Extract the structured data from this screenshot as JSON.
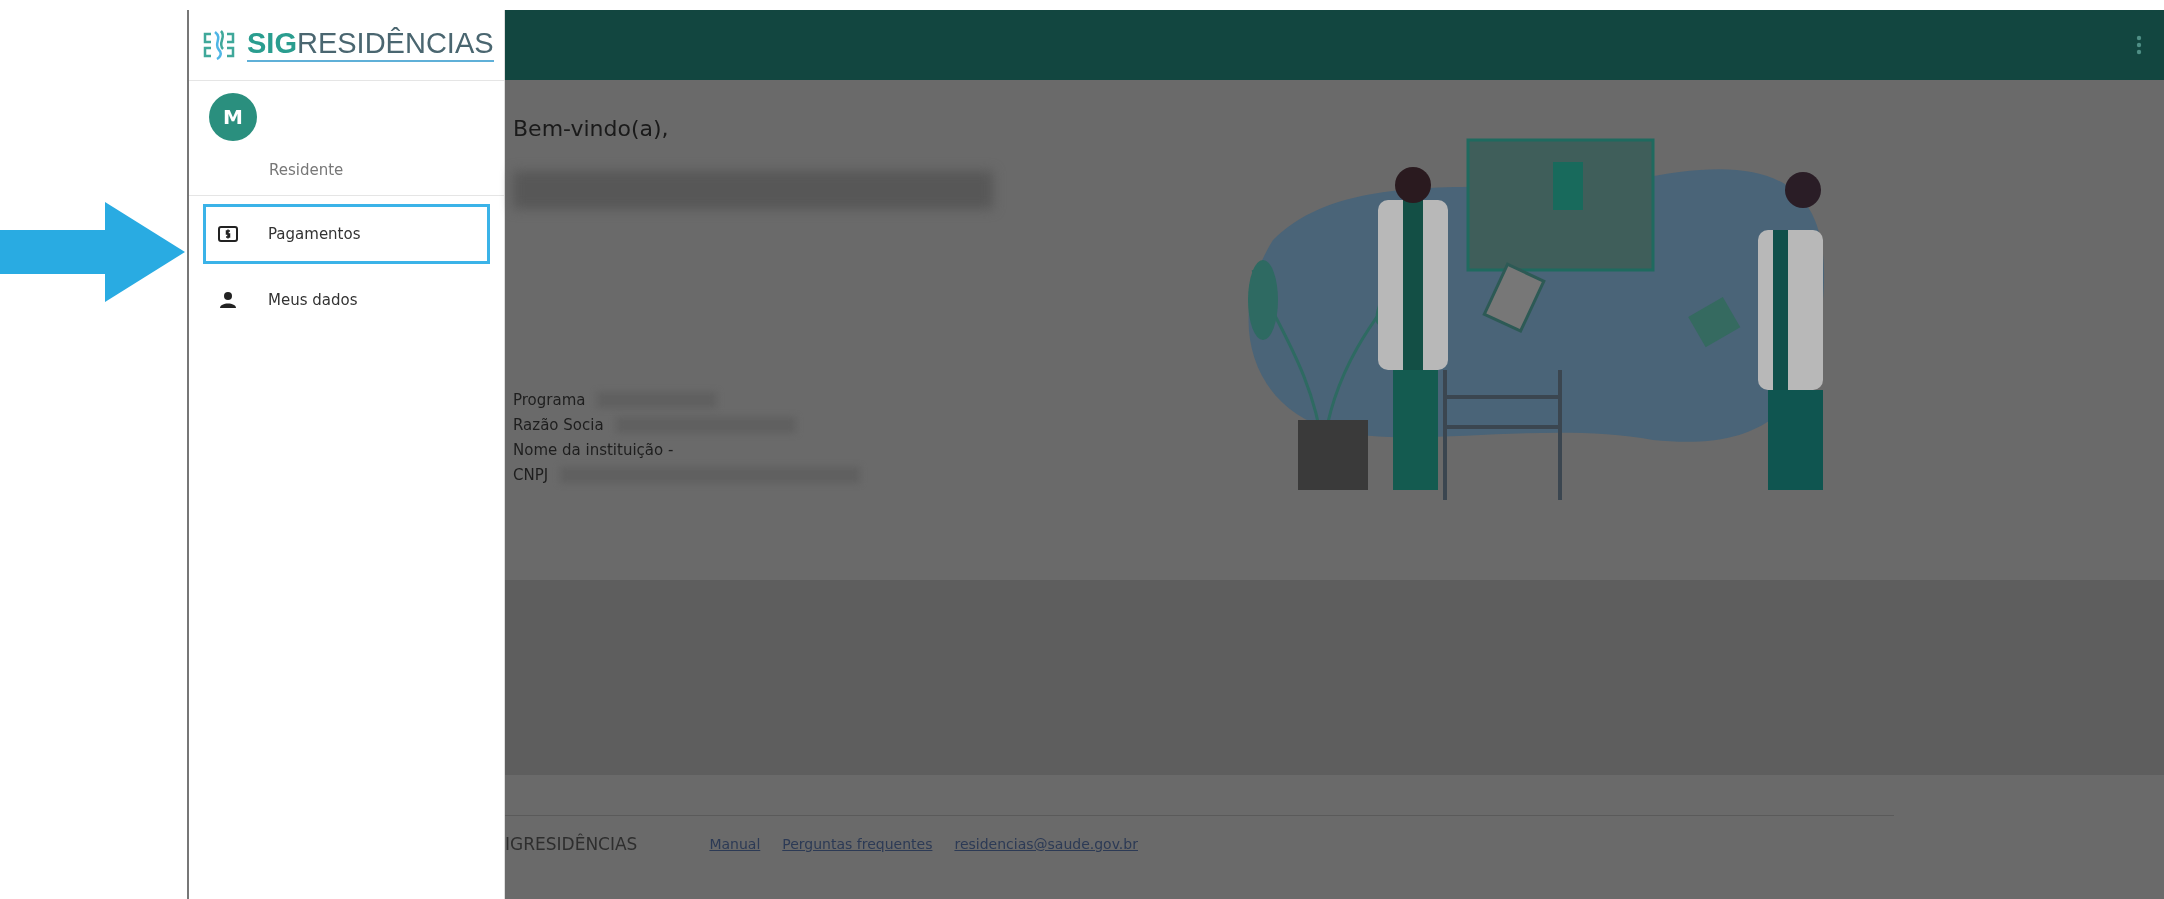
{
  "sidebar": {
    "logo": {
      "prefix": "SIG",
      "suffix": "RESIDÊNCIAS"
    },
    "user": {
      "initial": "M",
      "role": "Residente"
    },
    "items": [
      {
        "label": "Pagamentos",
        "kind": "money",
        "highlighted": true
      },
      {
        "label": "Meus dados",
        "kind": "person",
        "highlighted": false
      }
    ]
  },
  "main": {
    "greeting": "Bem-vindo(a),",
    "fields": [
      {
        "label": "Programa",
        "redacted": true
      },
      {
        "label": "Razão Socia",
        "redacted": true
      },
      {
        "label": "Nome da instituição  -",
        "redacted": false
      },
      {
        "label": "CNPJ",
        "redacted": true
      }
    ]
  },
  "footer": {
    "brand": "IGRESIDÊNCIAS",
    "links": [
      "Manual",
      "Perguntas frequentes",
      "residencias@saude.gov.br"
    ]
  }
}
